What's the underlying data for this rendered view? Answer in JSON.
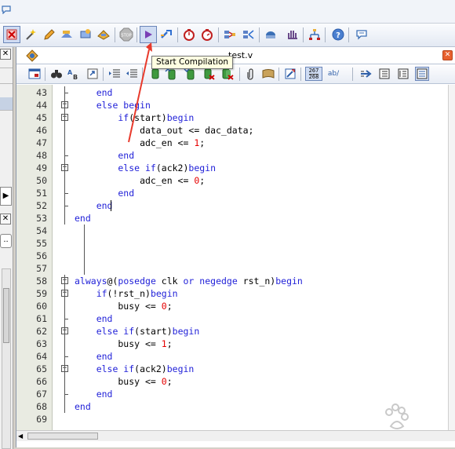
{
  "tooltip": {
    "text": "Start Compilation"
  },
  "document": {
    "tab_title": "test.v",
    "close_glyph": "✕"
  },
  "editor_toolbar": {
    "line_counter_top": "267",
    "line_counter_bottom": "268",
    "ab_label": "ab/"
  },
  "code": {
    "lines": [
      {
        "n": "43",
        "segs": [
          [
            "kw",
            "    end"
          ]
        ]
      },
      {
        "n": "44",
        "segs": [
          [
            "kw",
            "    else begin"
          ]
        ]
      },
      {
        "n": "45",
        "segs": [
          [
            "kw",
            "        if"
          ],
          [
            "op",
            "(start)"
          ],
          [
            "kw",
            "begin"
          ]
        ]
      },
      {
        "n": "46",
        "segs": [
          [
            "op",
            "            data_out <= dac_data;"
          ]
        ]
      },
      {
        "n": "47",
        "segs": [
          [
            "op",
            "            adc_en <= "
          ],
          [
            "num",
            "1"
          ],
          [
            "op",
            ";"
          ]
        ]
      },
      {
        "n": "48",
        "segs": [
          [
            "kw",
            "        end"
          ]
        ]
      },
      {
        "n": "49",
        "segs": [
          [
            "kw",
            "        else if"
          ],
          [
            "op",
            "(ack2)"
          ],
          [
            "kw",
            "begin"
          ]
        ]
      },
      {
        "n": "50",
        "segs": [
          [
            "op",
            "            adc_en <= "
          ],
          [
            "num",
            "0"
          ],
          [
            "op",
            ";"
          ]
        ]
      },
      {
        "n": "51",
        "segs": [
          [
            "kw",
            "        end"
          ]
        ]
      },
      {
        "n": "52",
        "segs": [
          [
            "kw",
            "    end"
          ]
        ]
      },
      {
        "n": "53",
        "segs": [
          [
            "kw",
            "end"
          ]
        ]
      },
      {
        "n": "54",
        "segs": []
      },
      {
        "n": "55",
        "segs": []
      },
      {
        "n": "56",
        "segs": []
      },
      {
        "n": "57",
        "segs": []
      },
      {
        "n": "58",
        "segs": [
          [
            "kw",
            "always"
          ],
          [
            "op",
            "@("
          ],
          [
            "kw",
            "posedge"
          ],
          [
            "op",
            " clk "
          ],
          [
            "kw",
            "or"
          ],
          [
            "op",
            " "
          ],
          [
            "kw",
            "negedge"
          ],
          [
            "op",
            " rst_n)"
          ],
          [
            "kw",
            "begin"
          ]
        ]
      },
      {
        "n": "59",
        "segs": [
          [
            "kw",
            "    if"
          ],
          [
            "op",
            "(!rst_n)"
          ],
          [
            "kw",
            "begin"
          ]
        ]
      },
      {
        "n": "60",
        "segs": [
          [
            "op",
            "        busy <= "
          ],
          [
            "num",
            "0"
          ],
          [
            "op",
            ";"
          ]
        ]
      },
      {
        "n": "61",
        "segs": [
          [
            "kw",
            "    end"
          ]
        ]
      },
      {
        "n": "62",
        "segs": [
          [
            "kw",
            "    else if"
          ],
          [
            "op",
            "(start)"
          ],
          [
            "kw",
            "begin"
          ]
        ]
      },
      {
        "n": "63",
        "segs": [
          [
            "op",
            "        busy <= "
          ],
          [
            "num",
            "1"
          ],
          [
            "op",
            ";"
          ]
        ]
      },
      {
        "n": "64",
        "segs": [
          [
            "kw",
            "    end"
          ]
        ]
      },
      {
        "n": "65",
        "segs": [
          [
            "kw",
            "    else if"
          ],
          [
            "op",
            "(ack2)"
          ],
          [
            "kw",
            "begin"
          ]
        ]
      },
      {
        "n": "66",
        "segs": [
          [
            "op",
            "        busy <= "
          ],
          [
            "num",
            "0"
          ],
          [
            "op",
            ";"
          ]
        ]
      },
      {
        "n": "67",
        "segs": [
          [
            "kw",
            "    end"
          ]
        ]
      },
      {
        "n": "68",
        "segs": [
          [
            "kw",
            "end"
          ]
        ]
      },
      {
        "n": "69",
        "segs": []
      }
    ]
  },
  "colors": {
    "keyword": "#1f1fd8",
    "number": "#e60000",
    "arrow": "#e83a2c"
  },
  "icons": {
    "main_toolbar": [
      "stop-processing-icon",
      "magic-wand-icon",
      "pencil-icon",
      "settings-icon",
      "chip-icon",
      "chip-2-icon",
      "stop-icon",
      "start-compilation-icon",
      "analysis-icon",
      "timer-icon",
      "timer-2-icon",
      "netlist-icon",
      "netlist-2-icon",
      "programmer-icon",
      "hand-icon",
      "tree-icon",
      "help-icon",
      "comment-icon"
    ],
    "editor_toolbar": [
      "find-icon",
      "find-binoculars-icon",
      "replace-icon",
      "goto-line-icon",
      "indent-icon",
      "unindent-icon",
      "bookmark-icon",
      "bookmark-next-icon",
      "bookmark-prev-icon",
      "bookmark-clear-icon",
      "bookmark-clear-2-icon",
      "attach-icon",
      "template-icon",
      "insert-template-icon",
      "line-counter-icon",
      "ab-icon",
      "go-icon",
      "block-comment-icon",
      "block-uncomment-icon",
      "view-icon"
    ]
  }
}
